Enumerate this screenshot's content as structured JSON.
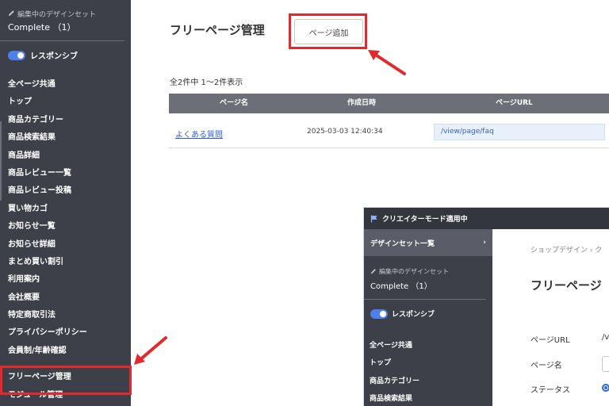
{
  "sidebar": {
    "design_set_label": "編集中のデザインセット",
    "design_set_name": "Complete （1）",
    "responsive_label": "レスポンシブ",
    "items": [
      {
        "label": "全ページ共通"
      },
      {
        "label": "トップ"
      },
      {
        "label": "商品カテゴリー"
      },
      {
        "label": "商品検索結果"
      },
      {
        "label": "商品詳細"
      },
      {
        "label": "商品レビュー一覧"
      },
      {
        "label": "商品レビュー投稿"
      },
      {
        "label": "買い物カゴ"
      },
      {
        "label": "お知らせ一覧"
      },
      {
        "label": "お知らせ詳細"
      },
      {
        "label": "まとめ買い割引"
      },
      {
        "label": "利用案内"
      },
      {
        "label": "会社概要"
      },
      {
        "label": "特定商取引法"
      },
      {
        "label": "プライバシーポリシー"
      },
      {
        "label": "会員制/年齢確認"
      }
    ],
    "active_item": "フリーページ管理",
    "next_item": "モジュール管理"
  },
  "main": {
    "title": "フリーページ管理",
    "add_button": "ページ追加",
    "count_text": "全2件中 1〜2件表示",
    "table": {
      "headers": [
        "ページ名",
        "作成日時",
        "ページURL"
      ],
      "rows": [
        {
          "name": "よくある質問",
          "created": "2025-03-03 12:40:34",
          "url": "/view/page/faq"
        }
      ]
    }
  },
  "inset": {
    "topbar": "クリエイターモード適用中",
    "design_set_list": "デザインセット一覧",
    "design_set_label": "編集中のデザインセット",
    "design_set_name": "Complete （1）",
    "responsive_label": "レスポンシブ",
    "items": [
      {
        "label": "全ページ共通"
      },
      {
        "label": "トップ"
      },
      {
        "label": "商品カテゴリー"
      },
      {
        "label": "商品検索結果"
      }
    ],
    "breadcrumb": "ショップデザイン › ク",
    "title": "フリーページ",
    "fields": {
      "url_label": "ページURL",
      "url_value": "/v",
      "name_label": "ページ名",
      "status_label": "ステータス"
    }
  },
  "colors": {
    "sidebar_bg": "#3e4049",
    "highlight": "#e4292d",
    "link": "#2f5fd0",
    "toggle": "#4f7fe8"
  }
}
